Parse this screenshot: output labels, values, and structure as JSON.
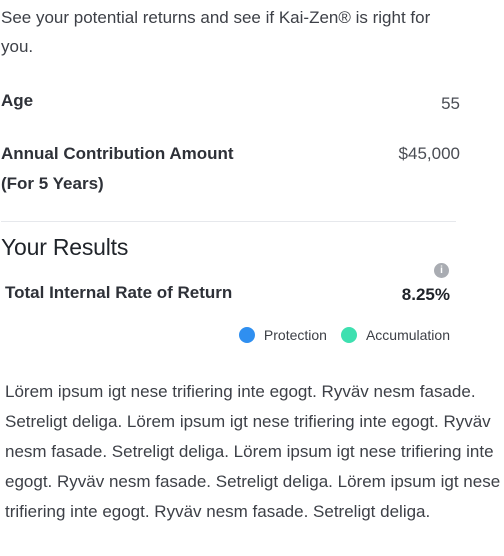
{
  "intro": "See your potential returns and see if Kai-Zen® is right for you.",
  "age": {
    "label": "Age",
    "value": "55"
  },
  "contribution": {
    "label_line1": "Annual Contribution Amount",
    "label_line2": "(For 5 Years)",
    "value": "$45,000"
  },
  "results": {
    "title": "Your Results",
    "info_icon": "info-icon",
    "irr_label": "Total Internal Rate of Return",
    "irr_value": "8.25%"
  },
  "legend": {
    "items": [
      {
        "label": "Protection",
        "color": "#2f8ff0"
      },
      {
        "label": "Accumulation",
        "color": "#3ee0b0"
      }
    ]
  },
  "body_text": "Lörem ipsum igt nese trifiering inte egogt. Ryväv nesm fasade. Setreligt deliga. Lörem ipsum igt nese trifiering inte egogt. Ryväv nesm fasade. Setreligt deliga. Lörem ipsum igt nese trifiering inte egogt. Ryväv nesm fasade. Setreligt deliga. Lörem ipsum igt nese trifiering inte egogt. Ryväv nesm fasade. Setreligt deliga."
}
